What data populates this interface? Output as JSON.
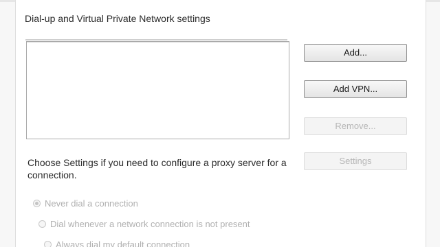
{
  "section": {
    "title": "Dial-up and Virtual Private Network settings"
  },
  "buttons": {
    "add": "Add...",
    "add_vpn": "Add VPN...",
    "remove": "Remove...",
    "settings": "Settings"
  },
  "help": {
    "text": "Choose Settings if you need to configure a proxy server for a connection."
  },
  "options": [
    {
      "label": "Never dial a connection",
      "selected": true
    },
    {
      "label": "Dial whenever a network connection is not present",
      "selected": false
    },
    {
      "label": "Always dial my default connection",
      "selected": false
    }
  ]
}
